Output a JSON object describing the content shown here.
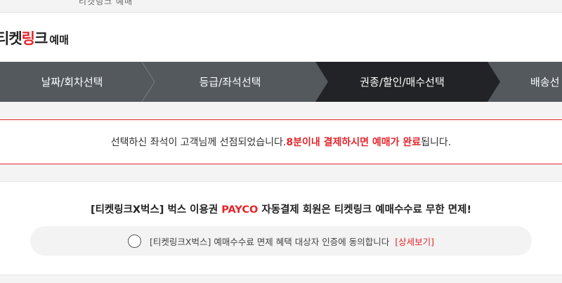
{
  "top_bar": {
    "text": "티켓링크 예매"
  },
  "logo": {
    "part1": "티켓",
    "part2": "링",
    "part3": "크",
    "suffix": "예매"
  },
  "steps": [
    {
      "label": "날짜/회차선택",
      "active": false
    },
    {
      "label": "등급/좌석선택",
      "active": false
    },
    {
      "label": "권종/할인/매수선택",
      "active": true
    },
    {
      "label": "배송선",
      "active": false
    }
  ],
  "notice": {
    "text_plain": "선택하신 좌석이 고객님께 선점되었습니다. ",
    "text_red": "8분이내 결제하시면 예매가 완료",
    "text_end": "됩니다."
  },
  "promo": {
    "title_pre": "[티켓링크X벅스] 벅스 이용권 ",
    "title_payco": "PAYCO",
    "title_post": " 자동결제 회원은 티켓링크 예매수수료 무한 면제!",
    "agree_label": "[티켓링크X벅스] 예매수수료 면제 혜택 대상자 인증에 동의합니다",
    "detail_link": "[상세보기]"
  },
  "colors": {
    "accent": "#e4262d",
    "step_bg": "#54595e",
    "step_active": "#222326"
  }
}
